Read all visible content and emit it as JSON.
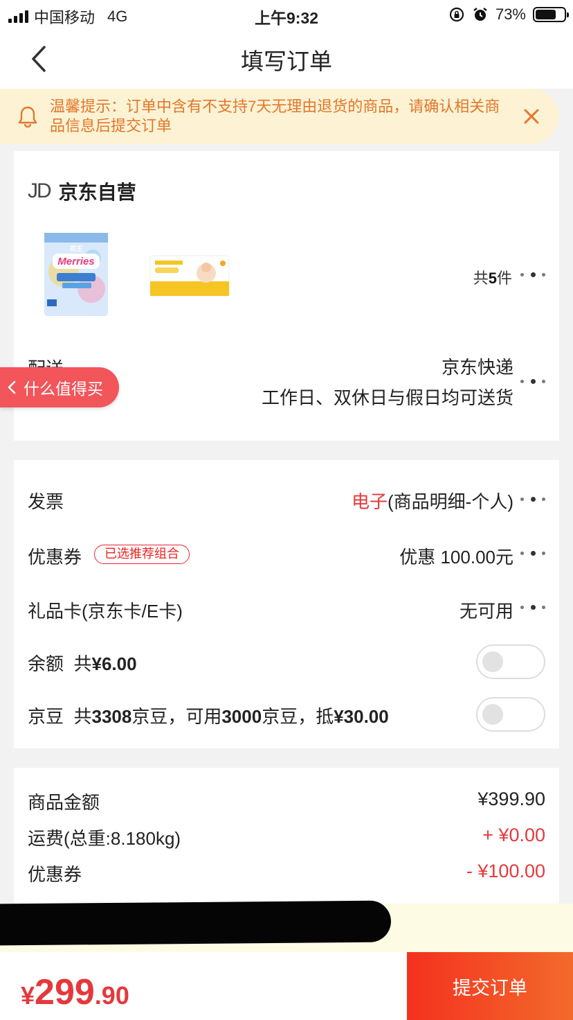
{
  "status_bar": {
    "carrier": "中国移动",
    "network": "4G",
    "time": "上午9:32",
    "battery_text": "73%",
    "battery_level": 0.73
  },
  "nav": {
    "title": "填写订单"
  },
  "notice": {
    "text": "温馨提示：订单中含有不支持7天无理由退货的商品，请确认相关商品信息后提交订单",
    "color": "#e4762b",
    "icon": "bell-icon",
    "close_icon": "close-icon"
  },
  "shop": {
    "logo": "JD",
    "name": "京东自营",
    "quantity_prefix": "共",
    "quantity": "5",
    "quantity_suffix": "件",
    "products": [
      {
        "brand_text": "Merries",
        "sub_text": "花王",
        "icon": "diaper-pack-image"
      },
      {
        "icon": "wipes-pack-image"
      }
    ]
  },
  "delivery": {
    "label": "配送",
    "method": "京东快递",
    "schedule": "工作日、双休日与假日均可送货"
  },
  "floating_tag": {
    "text": "什么值得买"
  },
  "invoice": {
    "label": "发票",
    "value_highlight": "电子",
    "value_rest": "(商品明细-个人)"
  },
  "coupon": {
    "label": "优惠券",
    "badge": "已选推荐组合",
    "value": "优惠 100.00元"
  },
  "gift_card": {
    "label": "礼品卡(京东卡/E卡)",
    "value": "无可用"
  },
  "balance": {
    "label": "余额",
    "prefix": "共",
    "amount": "¥6.00",
    "enabled": false
  },
  "jingdou": {
    "label": "京豆",
    "t1": "共",
    "total": "3308",
    "t2": "京豆，可用",
    "usable": "3000",
    "t3": "京豆，抵",
    "deduct": "¥30.00",
    "enabled": false
  },
  "summary": {
    "goods_label": "商品金额",
    "goods_value": "¥399.90",
    "shipping_label": "运费(总重:8.180kg)",
    "shipping_value": "+ ¥0.00",
    "coupon_label": "优惠券",
    "coupon_value": "- ¥100.00"
  },
  "footer": {
    "currency": "¥",
    "total_int": "299",
    "total_dec": ".90",
    "submit_label": "提交订单"
  },
  "colors": {
    "accent_red": "#e4393c",
    "notice_bg": "#fdf3d4"
  }
}
